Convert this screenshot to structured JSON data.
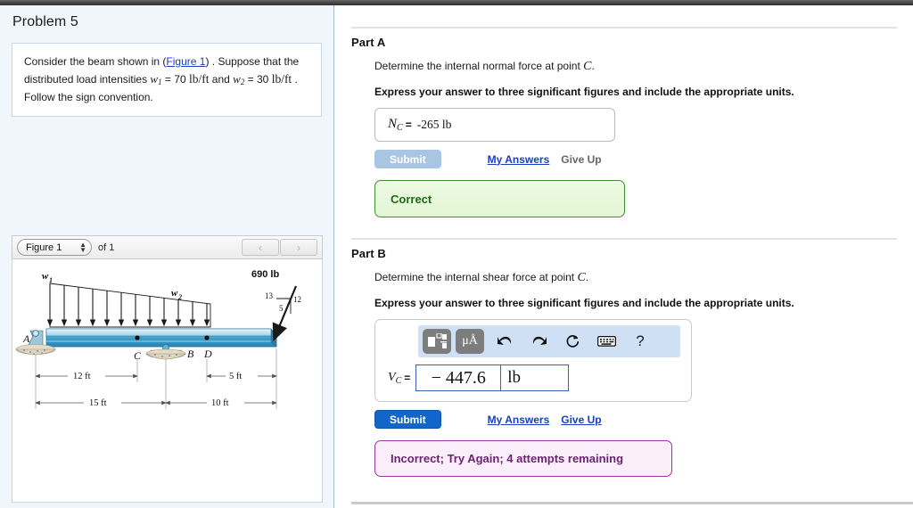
{
  "left": {
    "problem_title": "Problem 5",
    "statement": {
      "lead": "Consider the beam shown in (",
      "figure_link": "Figure 1",
      "mid": ") . Suppose that the distributed load intensities ",
      "w1_symbol": "w",
      "w1_sub": "1",
      "w1_eq": " = 70 ",
      "w1_units": "lb/ft",
      "and": " and ",
      "w2_symbol": "w",
      "w2_sub": "2",
      "w2_eq": " = 30 ",
      "w2_units": "lb/ft",
      "tail": " . Follow the sign convention."
    },
    "figure_nav": {
      "selected": "Figure 1",
      "of_label": "of 1",
      "prev_icon": "chevron-left-icon",
      "next_icon": "chevron-right-icon"
    },
    "figure": {
      "load_label_1": "w",
      "load_label_1_sub": "1",
      "load_label_2": "w",
      "load_label_2_sub": "2",
      "point_force": "690 lb",
      "tri_hyp": "13",
      "tri_vert": "12",
      "tri_horz": "5",
      "pt_a": "A",
      "pt_b": "B",
      "pt_c": "C",
      "pt_d": "D",
      "dim_12": "12 ft",
      "dim_5": "5 ft",
      "dim_15": "15 ft",
      "dim_10": "10 ft"
    }
  },
  "right": {
    "part_a": {
      "heading": "Part A",
      "prompt_pre": "Determine the internal normal force at point ",
      "prompt_var": "C",
      "prompt_post": ".",
      "instruction": "Express your answer to three significant figures and include the appropriate units.",
      "answer_var": "N",
      "answer_var_sub": "C",
      "equals": "=",
      "answer_value": "-265 lb",
      "submit_label": "Submit",
      "my_answers_label": "My Answers",
      "give_up_label": "Give Up",
      "feedback": "Correct"
    },
    "part_b": {
      "heading": "Part B",
      "prompt_pre": "Determine the internal shear force at point ",
      "prompt_var": "C",
      "prompt_post": ".",
      "instruction": "Express your answer to three significant figures and include the appropriate units.",
      "answer_var": "V",
      "answer_var_sub": "C",
      "equals": "=",
      "answer_value": "− 447.6",
      "units_value": "lb",
      "toolbar": {
        "template_icon": "math-template-icon",
        "units_icon": "mu-angstrom-units-icon",
        "units_label": "μÅ",
        "undo_icon": "undo-arrow-icon",
        "undo_glyph": "←",
        "redo_icon": "redo-arrow-icon",
        "redo_glyph": "→",
        "reset_icon": "reset-circular-arrow-icon",
        "reset_glyph": "↺",
        "keyboard_icon": "keyboard-icon",
        "help_icon": "help-question-icon",
        "help_glyph": "?"
      },
      "submit_label": "Submit",
      "my_answers_label": "My Answers",
      "give_up_label": "Give Up",
      "feedback": "Incorrect; Try Again; 4 attempts remaining"
    }
  },
  "colors": {
    "panel_bg": "#f1f6fc",
    "link": "#1a3fbf",
    "submit_active": "#1266c9",
    "submit_disabled": "#a8c6e2",
    "correct_text": "#1c6b12",
    "correct_bg": "#e9f8dc",
    "incorrect_text": "#6b2470",
    "incorrect_bg": "#faeefb",
    "toolbar_bg": "#cfe0f5",
    "beam_blue": "#3f9fd0"
  }
}
